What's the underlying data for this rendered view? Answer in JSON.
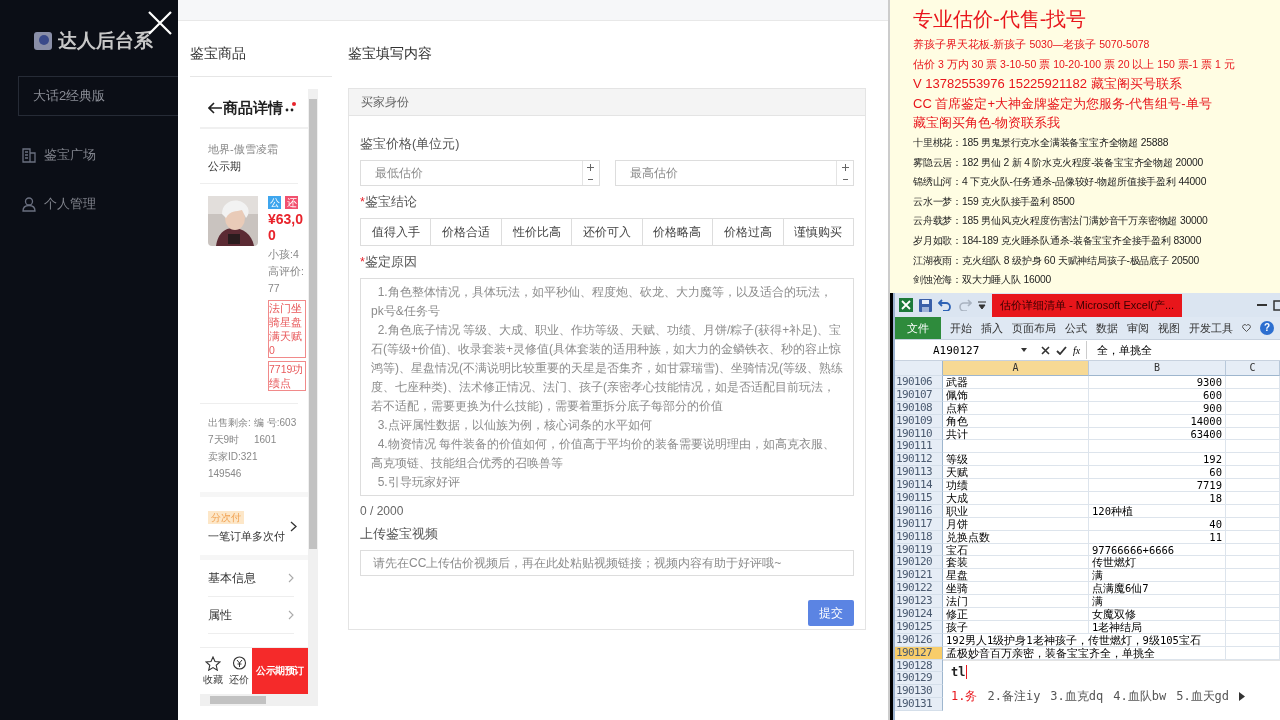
{
  "sidebar": {
    "logo": "达人后台系",
    "game_select": "大话2经典版",
    "menu": [
      {
        "label": "鉴宝广场"
      },
      {
        "label": "个人管理"
      }
    ]
  },
  "modal": {
    "left_title": "鉴宝商品",
    "right_title": "鉴宝填写内容"
  },
  "phone": {
    "title": "商品详情",
    "server": "地界-傲雪凌霜",
    "status": "公示期",
    "tags": [
      {
        "text": "公",
        "color": "#3ea6ee"
      },
      {
        "text": "还",
        "color": "#f2506e"
      }
    ],
    "price": "¥63,00",
    "stats": [
      "小孩:4",
      "高评价:",
      "77"
    ],
    "highlights": [
      "法门坐骑星盘满天赋0",
      "7719功绩点"
    ],
    "sale_remaining": "出售剩余: 7天9时",
    "serial": "编 号:6031601",
    "seller_id": "卖家ID:321149546",
    "pay_badge": "分次付",
    "pay_text": "一笔订单多次付",
    "menu": [
      "基本信息",
      "属性"
    ],
    "actions": [
      {
        "label": "收藏"
      },
      {
        "label": "还价"
      }
    ],
    "reserve_button": "公示期预订"
  },
  "form": {
    "section": "买家身份",
    "price_label": {
      "text": "鉴宝价格(单位元)"
    },
    "price_inputs": [
      {
        "placeholder": "最低估价"
      },
      {
        "placeholder": "最高估价"
      }
    ],
    "conclusion_label": {
      "text": "鉴宝结论",
      "mark": "*"
    },
    "conclusions": [
      {
        "label": "值得入手",
        "selected": false
      },
      {
        "label": "价格合适",
        "selected": false
      },
      {
        "label": "性价比高",
        "selected": false
      },
      {
        "label": "还价可入",
        "selected": false
      },
      {
        "label": "价格略高",
        "selected": false
      },
      {
        "label": "价格过高",
        "selected": false
      },
      {
        "label": "谨慎购买",
        "selected": false
      }
    ],
    "reason_label": {
      "text": "鉴定原因",
      "mark": "*"
    },
    "reason_placeholder": "  1.角色整体情况，具体玩法，如平秒仙、程度炮、砍龙、大力魔等，以及适合的玩法，pk号&任务号\n  2.角色底子情况 等级、大成、职业、作坊等级、天赋、功绩、月饼/粽子(获得+补足)、宝石(等级+价值)、收录套装+灵修值(具体套装的适用种族，如大力的金鳞铁衣、秒的容止惊鸿等)、星盘情况(不满说明比较重要的天星是否集齐，如甘霖瑞雪)、坐骑情况(等级、熟练度、七座种类)、法术修正情况、法门、孩子(亲密孝心技能情况，如是否适配目前玩法，若不适配，需要更换为什么技能)，需要着重拆分底子每部分的价值\n  3.点评属性数据，以仙族为例，核心词条的水平如何\n  4.物资情况 每件装备的价值如何，价值高于平均价的装备需要说明理由，如高克衣服、高克项链、技能组合优秀的召唤兽等\n  5.引导玩家好评",
    "counter": "0 / 2000",
    "video_label": {
      "text": "上传鉴宝视频"
    },
    "video_placeholder": "请先在CC上传估价视频后，再在此处粘贴视频链接；视频内容有助于好评哦~",
    "submit": "提交"
  },
  "notice": [
    {
      "text": "专业估价-代售-找号",
      "kind": "headline"
    },
    {
      "text": "养孩子界天花板-新孩子 5030—老孩子 5070-5078",
      "kind": "red-small"
    },
    {
      "text": "估价 3 万内 30 票  3-10-50 票  10-20-100 票  20 以上 150 票-1 票 1 元",
      "kind": "red-small"
    },
    {
      "text": "V 13782553976    15225921182  藏宝阁买号联系",
      "kind": "red"
    },
    {
      "text": "CC 首席鉴定+大神金牌鉴定为您服务-代售组号-单号",
      "kind": "red"
    },
    {
      "text": "藏宝阁买角色-物资联系我",
      "kind": "red"
    },
    {
      "text": "十里桃花：185 男鬼景行克水全满装备宝宝齐全物超 25888",
      "kind": "plain"
    },
    {
      "text": "雾隐云居：182 男仙 2 新 4 阶水克火程度-装备宝宝齐全物超 20000",
      "kind": "plain"
    },
    {
      "text": "锦绣山河：4 下克火队-任务通杀-品像较好-物超所值接手盈利 44000",
      "kind": "plain"
    },
    {
      "text": "云水一梦：159 克火队接手盈利 8500",
      "kind": "plain"
    },
    {
      "text": "云舟载梦：185 男仙风克火程度伤害法门满妙音千万亲密物超 30000",
      "kind": "plain"
    },
    {
      "text": "岁月如歌：184-189 克火睡杀队通杀-装备宝宝齐全接手盈利 83000",
      "kind": "plain"
    },
    {
      "text": "江湖夜雨：克火组队 8 级护身 60 天赋神结局孩子-极品底子 20500",
      "kind": "plain"
    },
    {
      "text": "剑蚀沧海：双大力睡人队 16000",
      "kind": "plain"
    }
  ],
  "excel": {
    "title": "估价详细清单 - Microsoft Excel(产...",
    "ribbon_tabs": [
      {
        "label": "文件",
        "selected": true
      },
      {
        "label": "开始",
        "selected": false
      },
      {
        "label": "插入",
        "selected": false
      },
      {
        "label": "页面布局",
        "selected": false
      },
      {
        "label": "公式",
        "selected": false
      },
      {
        "label": "数据",
        "selected": false
      },
      {
        "label": "审阅",
        "selected": false
      },
      {
        "label": "视图",
        "selected": false
      },
      {
        "label": "开发工具",
        "selected": false
      }
    ],
    "help": "?",
    "name_box": "A190127",
    "fx": "fx",
    "formula": "全，单挑全",
    "columns": [
      {
        "label": "A",
        "selected": true
      },
      {
        "label": "B",
        "selected": false
      },
      {
        "label": "C",
        "selected": false
      }
    ],
    "rows": [
      {
        "num": "190106",
        "a": "武器",
        "b": "9300",
        "kind": "number",
        "selected": false
      },
      {
        "num": "190107",
        "a": "佩饰",
        "b": "600",
        "kind": "number",
        "selected": false
      },
      {
        "num": "190108",
        "a": "点粹",
        "b": "900",
        "kind": "number",
        "selected": false
      },
      {
        "num": "190109",
        "a": "角色",
        "b": "14000",
        "kind": "number",
        "selected": false
      },
      {
        "num": "190110",
        "a": "共计",
        "b": "63400",
        "kind": "number",
        "selected": false
      },
      {
        "num": "190111",
        "kind": "text",
        "selected": false
      },
      {
        "num": "190112",
        "a": "等级",
        "b": "192",
        "kind": "number",
        "selected": false
      },
      {
        "num": "190113",
        "a": "天赋",
        "b": "60",
        "kind": "number",
        "selected": false
      },
      {
        "num": "190114",
        "a": "功绩",
        "b": "7719",
        "kind": "number",
        "selected": false
      },
      {
        "num": "190115",
        "a": "大成",
        "b": "18",
        "kind": "number",
        "selected": false
      },
      {
        "num": "190116",
        "a": "职业",
        "b": "120种植",
        "kind": "text",
        "selected": false
      },
      {
        "num": "190117",
        "a": "月饼",
        "b": "40",
        "kind": "number",
        "selected": false
      },
      {
        "num": "190118",
        "a": "兑换点数",
        "b": "11",
        "kind": "number",
        "selected": false
      },
      {
        "num": "190119",
        "a": "宝石",
        "b": "97766666+6666",
        "kind": "text",
        "selected": false
      },
      {
        "num": "190120",
        "a": "套装",
        "b": "传世燃灯",
        "kind": "text",
        "selected": false
      },
      {
        "num": "190121",
        "a": "星盘",
        "b": "满",
        "kind": "text",
        "selected": false
      },
      {
        "num": "190122",
        "a": "坐骑",
        "b": "点满魔6仙7",
        "kind": "text",
        "selected": false
      },
      {
        "num": "190123",
        "a": "法门",
        "b": "满",
        "kind": "text",
        "selected": false
      },
      {
        "num": "190124",
        "a": "修正",
        "b": "女魔双修",
        "kind": "text",
        "selected": false
      },
      {
        "num": "190125",
        "a": "孩子",
        "b": "1老神结局",
        "kind": "text",
        "selected": false
      },
      {
        "num": "190126",
        "a": "192男人1级护身1老神孩子，传世燃灯，9级105宝石",
        "kind": "span",
        "selected": false
      },
      {
        "num": "190127",
        "a": "孟极妙音百万亲密，装备宝宝齐全，单挑全",
        "kind": "span",
        "selected": true
      },
      {
        "num": "190128",
        "selected": false
      },
      {
        "num": "190129",
        "selected": false
      },
      {
        "num": "190130",
        "selected": false
      },
      {
        "num": "190131",
        "selected": false
      }
    ],
    "ime": {
      "input": "tl",
      "candidates": [
        {
          "text": "1.务",
          "selected": true
        },
        {
          "text": "2.备注iy",
          "selected": false
        },
        {
          "text": "3.血克dq",
          "selected": false
        },
        {
          "text": "4.血队bw",
          "selected": false
        },
        {
          "text": "5.血天gd",
          "selected": false
        }
      ]
    }
  }
}
